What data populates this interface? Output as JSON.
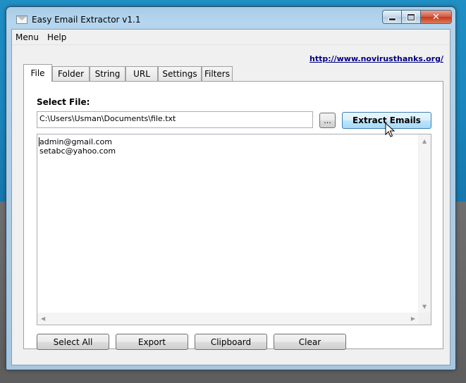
{
  "window": {
    "title": "Easy Email Extractor v1.1",
    "close_glyph": "✕"
  },
  "menu": {
    "items": [
      {
        "label": "Menu"
      },
      {
        "label": "Help"
      }
    ]
  },
  "link_text": "http://www.novirusthanks.org/",
  "tabs": [
    {
      "label": "File",
      "active": true
    },
    {
      "label": "Folder",
      "active": false
    },
    {
      "label": "String",
      "active": false
    },
    {
      "label": "URL",
      "active": false
    },
    {
      "label": "Settings",
      "active": false
    },
    {
      "label": "Filters",
      "active": false
    }
  ],
  "file_panel": {
    "select_label": "Select File:",
    "file_path": "C:\\Users\\Usman\\Documents\\file.txt",
    "browse_label": "...",
    "extract_label": "Extract Emails",
    "results": [
      "admin@gmail.com",
      "setabc@yahoo.com"
    ]
  },
  "buttons": {
    "select_all": "Select All",
    "export": "Export",
    "clipboard": "Clipboard",
    "clear": "Clear"
  },
  "colors": {
    "link": "#000080",
    "extract_button_border": "#3c7fb1"
  },
  "icons": {
    "app": "envelope-icon",
    "minimize": "minimize-icon",
    "maximize": "maximize-icon",
    "close": "close-icon",
    "cursor": "mouse-cursor-icon"
  }
}
